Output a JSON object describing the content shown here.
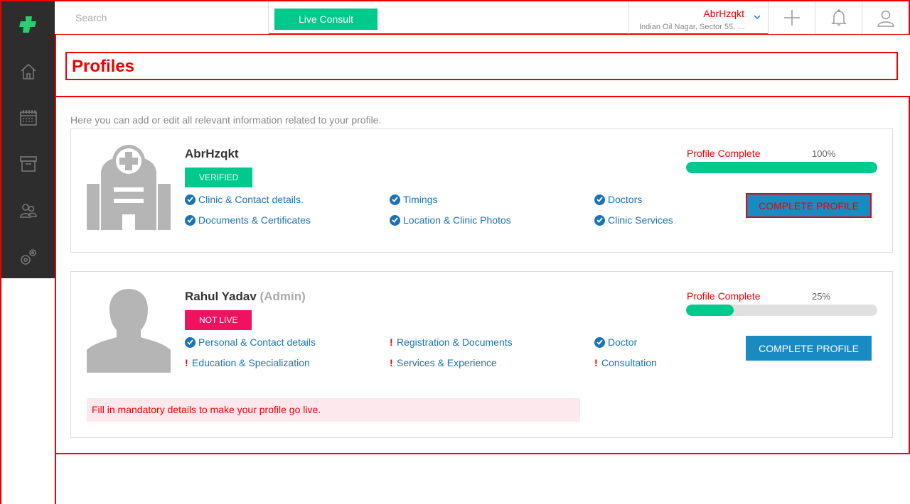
{
  "topbar": {
    "search_placeholder": "Search",
    "live_consult": "Live Consult",
    "location_name": "AbrHzqkt",
    "location_address": "Indian Oil Nagar, Sector 55, N..."
  },
  "page": {
    "title": "Profiles",
    "intro": "Here you can add or edit all relevant information related to your profile."
  },
  "profiles": [
    {
      "name": "AbrHzqkt",
      "role": "",
      "badge": "VERIFIED",
      "progress_label": "Profile Complete",
      "progress_text": "100%",
      "progress": 1.0,
      "button": "COMPLETE PROFILE",
      "items": [
        {
          "label": "Clinic & Contact details.",
          "status": "done"
        },
        {
          "label": "Timings",
          "status": "done"
        },
        {
          "label": "Doctors",
          "status": "done"
        },
        {
          "label": "Documents & Certificates",
          "status": "done"
        },
        {
          "label": "Location & Clinic Photos",
          "status": "done"
        },
        {
          "label": "Clinic Services",
          "status": "done"
        }
      ]
    },
    {
      "name": "Rahul Yadav",
      "role": "(Admin)",
      "badge": "NOT LIVE",
      "progress_label": "Profile Complete",
      "progress_text": "25%",
      "progress": 0.25,
      "button": "COMPLETE PROFILE",
      "items": [
        {
          "label": "Personal & Contact details",
          "status": "done"
        },
        {
          "label": "Registration & Documents",
          "status": "missing"
        },
        {
          "label": "Doctor",
          "status": "done"
        },
        {
          "label": "Education & Specialization",
          "status": "missing"
        },
        {
          "label": "Services & Experience",
          "status": "missing"
        },
        {
          "label": "Consultation",
          "status": "missing"
        }
      ],
      "warning": "Fill in mandatory details to make your profile go live."
    }
  ],
  "colors": {
    "accent": "#00c98d",
    "link": "#1a73b5",
    "alert": "#e00000",
    "sidebar": "#2d2d2d"
  }
}
